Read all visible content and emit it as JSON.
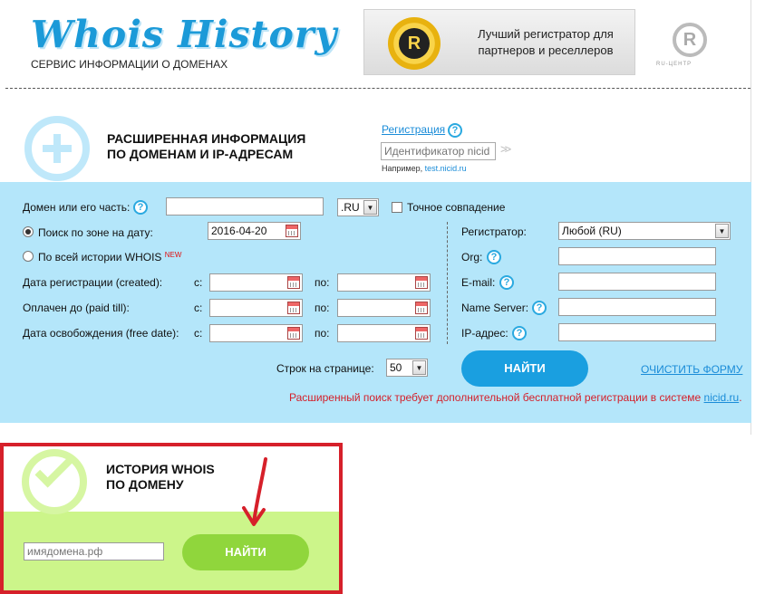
{
  "header": {
    "logo": "Whois History",
    "tagline": "СЕРВИС ИНФОРМАЦИИ О ДОМЕНАХ",
    "banner_text": "Лучший регистратор для партнеров и реселлеров",
    "banner_icon": "registrar-seal-icon",
    "partner_logo_sub": "RU-ЦЕНТР"
  },
  "advanced": {
    "title_line1": "РАСШИРЕННАЯ ИНФОРМАЦИЯ",
    "title_line2": "ПО ДОМЕНАМ И IP-АДРЕСАМ",
    "registration_link": "Регистрация",
    "help_glyph": "?",
    "nicid_placeholder": "Идентификатор nicid",
    "example_label": "Например,",
    "example_value": "test.nicid.ru"
  },
  "form": {
    "domain_label": "Домен или его часть:",
    "domain_value": "",
    "zone_value": ".RU",
    "exact_match_label": "Точное совпадение",
    "search_zone_label": "Поиск по зоне на дату:",
    "search_zone_date": "2016-04-20",
    "all_history_label": "По всей истории WHOIS",
    "new_badge": "NEW",
    "created_label": "Дата регистрации (created):",
    "paid_till_label": "Оплачен до (paid till):",
    "free_date_label": "Дата освобождения (free date):",
    "from_label": "с:",
    "to_label": "по:",
    "registrar_label": "Регистратор:",
    "registrar_value": "Любой (RU)",
    "org_label": "Org:",
    "email_label": "E-mail:",
    "ns_label": "Name Server:",
    "ip_label": "IP-адрес:",
    "rows_label": "Строк на странице:",
    "rows_value": "50",
    "find_button": "НАЙТИ",
    "clear_link": "ОЧИСТИТЬ ФОРМУ",
    "notice_text": "Расширенный поиск требует дополнительной бесплатной регистрации в системе",
    "notice_link": "nicid.ru",
    "notice_end": "."
  },
  "history": {
    "title_line1": "ИСТОРИЯ WHOIS",
    "title_line2": "ПО ДОМЕНУ",
    "domain_placeholder": "имядомена.рф",
    "find_button": "НАЙТИ"
  },
  "colors": {
    "accent_blue": "#1a9fe0",
    "panel_blue": "#b4e6fa",
    "panel_green": "#ccf58a",
    "button_green": "#90d63c",
    "highlight_red": "#d6202a"
  }
}
